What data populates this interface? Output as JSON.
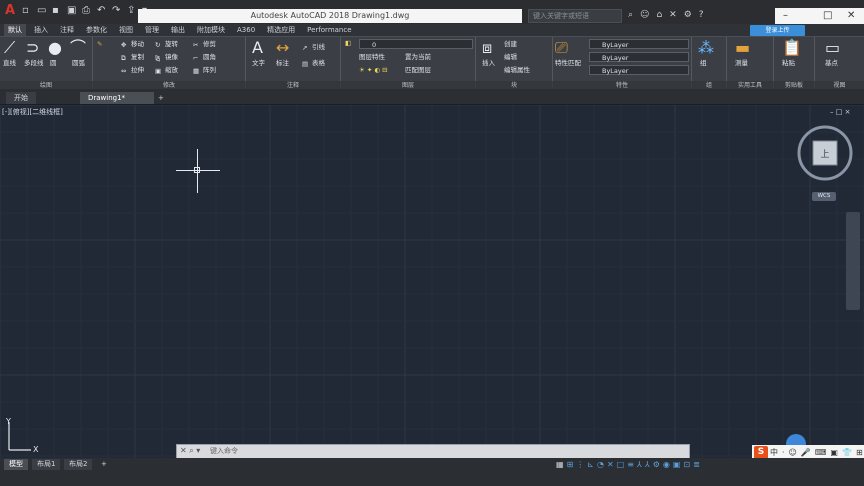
{
  "titlebar": {
    "app_title": "Autodesk AutoCAD 2018   Drawing1.dwg",
    "search_placeholder": "键入关键字或短语",
    "window_controls": {
      "minimize": "–",
      "maximize": "□",
      "close": "✕"
    }
  },
  "ribbon_tabs": [
    "默认",
    "插入",
    "注释",
    "参数化",
    "视图",
    "管理",
    "输出",
    "附加模块",
    "A360",
    "精选应用",
    "Performance"
  ],
  "login_button": "登录上传",
  "panels": [
    {
      "title": "绘图"
    },
    {
      "title": "修改"
    },
    {
      "title": "注释"
    },
    {
      "title": "图层"
    },
    {
      "title": "块"
    },
    {
      "title": "特性"
    },
    {
      "title": "组"
    },
    {
      "title": "实用工具"
    },
    {
      "title": "剪贴板"
    },
    {
      "title": "视图"
    }
  ],
  "draw_tools": [
    "直线",
    "多段线",
    "圆",
    "圆弧"
  ],
  "modify_tools": [
    "移动",
    "旋转",
    "修剪",
    "复制",
    "镜像",
    "圆角",
    "拉伸",
    "缩放",
    "阵列"
  ],
  "annotation_tools": [
    "文字",
    "标注",
    "引线",
    "表格"
  ],
  "layer_tools": [
    "图层特性",
    "置为当前",
    "匹配图层"
  ],
  "layer_current": "0",
  "block_tools": [
    "插入",
    "创建",
    "编辑",
    "编辑属性"
  ],
  "properties": {
    "color": "ByLayer",
    "linetype": "ByLayer",
    "lineweight": "ByLayer",
    "label_match": "特性匹配"
  },
  "group_tools": [
    "组"
  ],
  "utility_tools": [
    "测量"
  ],
  "clipboard_tools": [
    "粘贴"
  ],
  "view_tools": [
    "基点"
  ],
  "file_tabs": [
    "开始",
    "Drawing1*",
    "+"
  ],
  "viewport_label": "[-][俯视][二维线框]",
  "viewport_controls": "– □ ×",
  "viewcube": {
    "top_label": "上",
    "wcs_label": "WCS"
  },
  "command_prompt": "键入命令",
  "layout_tabs": [
    "模型",
    "布局1",
    "布局2",
    "+"
  ],
  "ime": {
    "logo": "S",
    "items": [
      "中",
      "·",
      "☺",
      "🎤",
      "⌨",
      "▣",
      "👕",
      "⊞"
    ]
  },
  "ucs": {
    "x_label": "X",
    "y_label": "Y"
  }
}
